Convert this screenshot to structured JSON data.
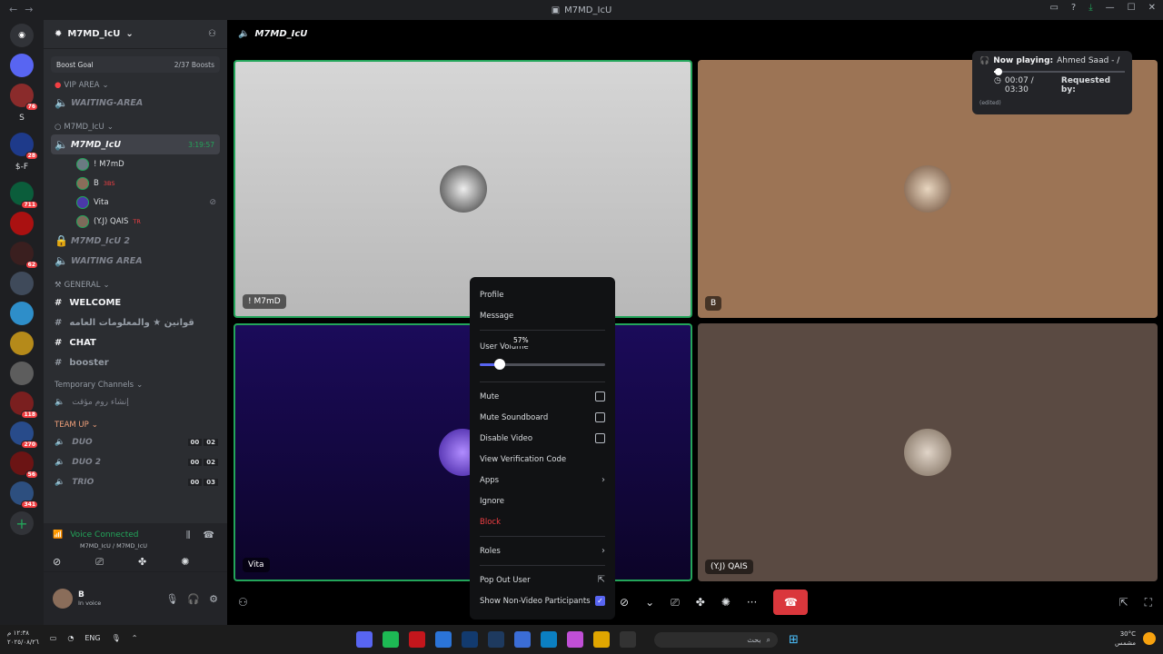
{
  "window": {
    "title": "M7MD_IcU"
  },
  "guilds": [
    {
      "type": "icon",
      "color": "#5865f2",
      "badge": ""
    },
    {
      "type": "icon",
      "color": "#8a2b2b",
      "badge": "76"
    },
    {
      "type": "text",
      "text": "S"
    },
    {
      "type": "icon",
      "color": "#1e3a8a",
      "badge": "28"
    },
    {
      "type": "text",
      "text": "$-F"
    },
    {
      "type": "icon",
      "color": "#0b5d3b",
      "badge": "711"
    },
    {
      "type": "icon",
      "color": "#a11"
    },
    {
      "type": "icon",
      "color": "#3a1f1f",
      "badge": "62"
    },
    {
      "type": "icon",
      "color": "#3f4a5a"
    },
    {
      "type": "icon",
      "color": "#2e8ec9"
    },
    {
      "type": "icon",
      "color": "#b58a1a"
    },
    {
      "type": "icon",
      "color": "#5d5d5d"
    },
    {
      "type": "icon",
      "color": "#7a1f1f",
      "badge": "118"
    },
    {
      "type": "icon",
      "color": "#284b8a",
      "badge": "270"
    },
    {
      "type": "icon",
      "color": "#6b1414",
      "badge": "56"
    },
    {
      "type": "icon",
      "color": "#2d4f7f",
      "badge": "341"
    }
  ],
  "server": {
    "name": "M7MD_IcU"
  },
  "boost": {
    "label": "Boost Goal",
    "count": "2/37 Boosts"
  },
  "sidebar": {
    "cat_vip": "VIP AREA",
    "waiting1": "WAITING-AREA",
    "cat_m7": "M7MD_IcU",
    "active_channel": "M7MD_IcU",
    "active_timer": "3:19:57",
    "users": [
      {
        "name": "! M7mD",
        "tag": "",
        "color": "#6b7a82"
      },
      {
        "name": "B",
        "tag": "3BS",
        "color": "#8a6d5a"
      },
      {
        "name": "Vita",
        "tag": "",
        "color": "#4b39a8"
      },
      {
        "name": "(Y.J) QAIS",
        "tag": "TR",
        "color": "#7d6a5a"
      }
    ],
    "channel_locked": "M7MD_IcU 2",
    "waiting2": "WAITING AREA",
    "cat_general": "GENERAL",
    "text_channels": [
      {
        "name": "WELCOME",
        "bright": true
      },
      {
        "name": "قوانين ★ والمعلومات العامه",
        "bright": false
      },
      {
        "name": "CHAT",
        "bright": true
      },
      {
        "name": "booster",
        "bright": false
      }
    ],
    "cat_temp": "Temporary Channels",
    "temp_channel": "إنشاء روم مؤقت",
    "cat_team": "TEAM UP",
    "voice_channels": [
      {
        "name": "DUO",
        "a": "00",
        "b": "02"
      },
      {
        "name": "DUO 2",
        "a": "00",
        "b": "02"
      },
      {
        "name": "TRIO",
        "a": "00",
        "b": "03"
      }
    ]
  },
  "voice": {
    "status": "Voice Connected",
    "channel": "M7MD_IcU / M7MD_IcU"
  },
  "user_panel": {
    "name": "B",
    "status": "In voice"
  },
  "stage": {
    "title": "M7MD_IcU"
  },
  "tiles": [
    {
      "label": "! M7mD"
    },
    {
      "label": "B"
    },
    {
      "label": "Vita"
    },
    {
      "label": "(Y.J) QAIS"
    }
  ],
  "now_playing": {
    "label": "Now playing:",
    "track": "Ahmed Saad - /",
    "time": "00:07 / 03:30",
    "requested": "Requested by:",
    "edited": "(edited)",
    "progress": 0.033
  },
  "context_menu": {
    "profile": "Profile",
    "message": "Message",
    "volume_label": "User Volume",
    "volume_value": "57%",
    "volume_fraction": 0.57,
    "mute": "Mute",
    "mute_soundboard": "Mute Soundboard",
    "disable_video": "Disable Video",
    "verification": "View Verification Code",
    "apps": "Apps",
    "ignore": "Ignore",
    "block": "Block",
    "roles": "Roles",
    "popout": "Pop Out User",
    "show_nonvideo": "Show Non-Video Participants"
  },
  "taskbar": {
    "time": "١٢:٣٨ م",
    "date": "٢٠٢٥/٠٨/٢٦",
    "lang": "ENG",
    "search": "بحث",
    "temp": "30°C",
    "weather": "مشمس"
  }
}
